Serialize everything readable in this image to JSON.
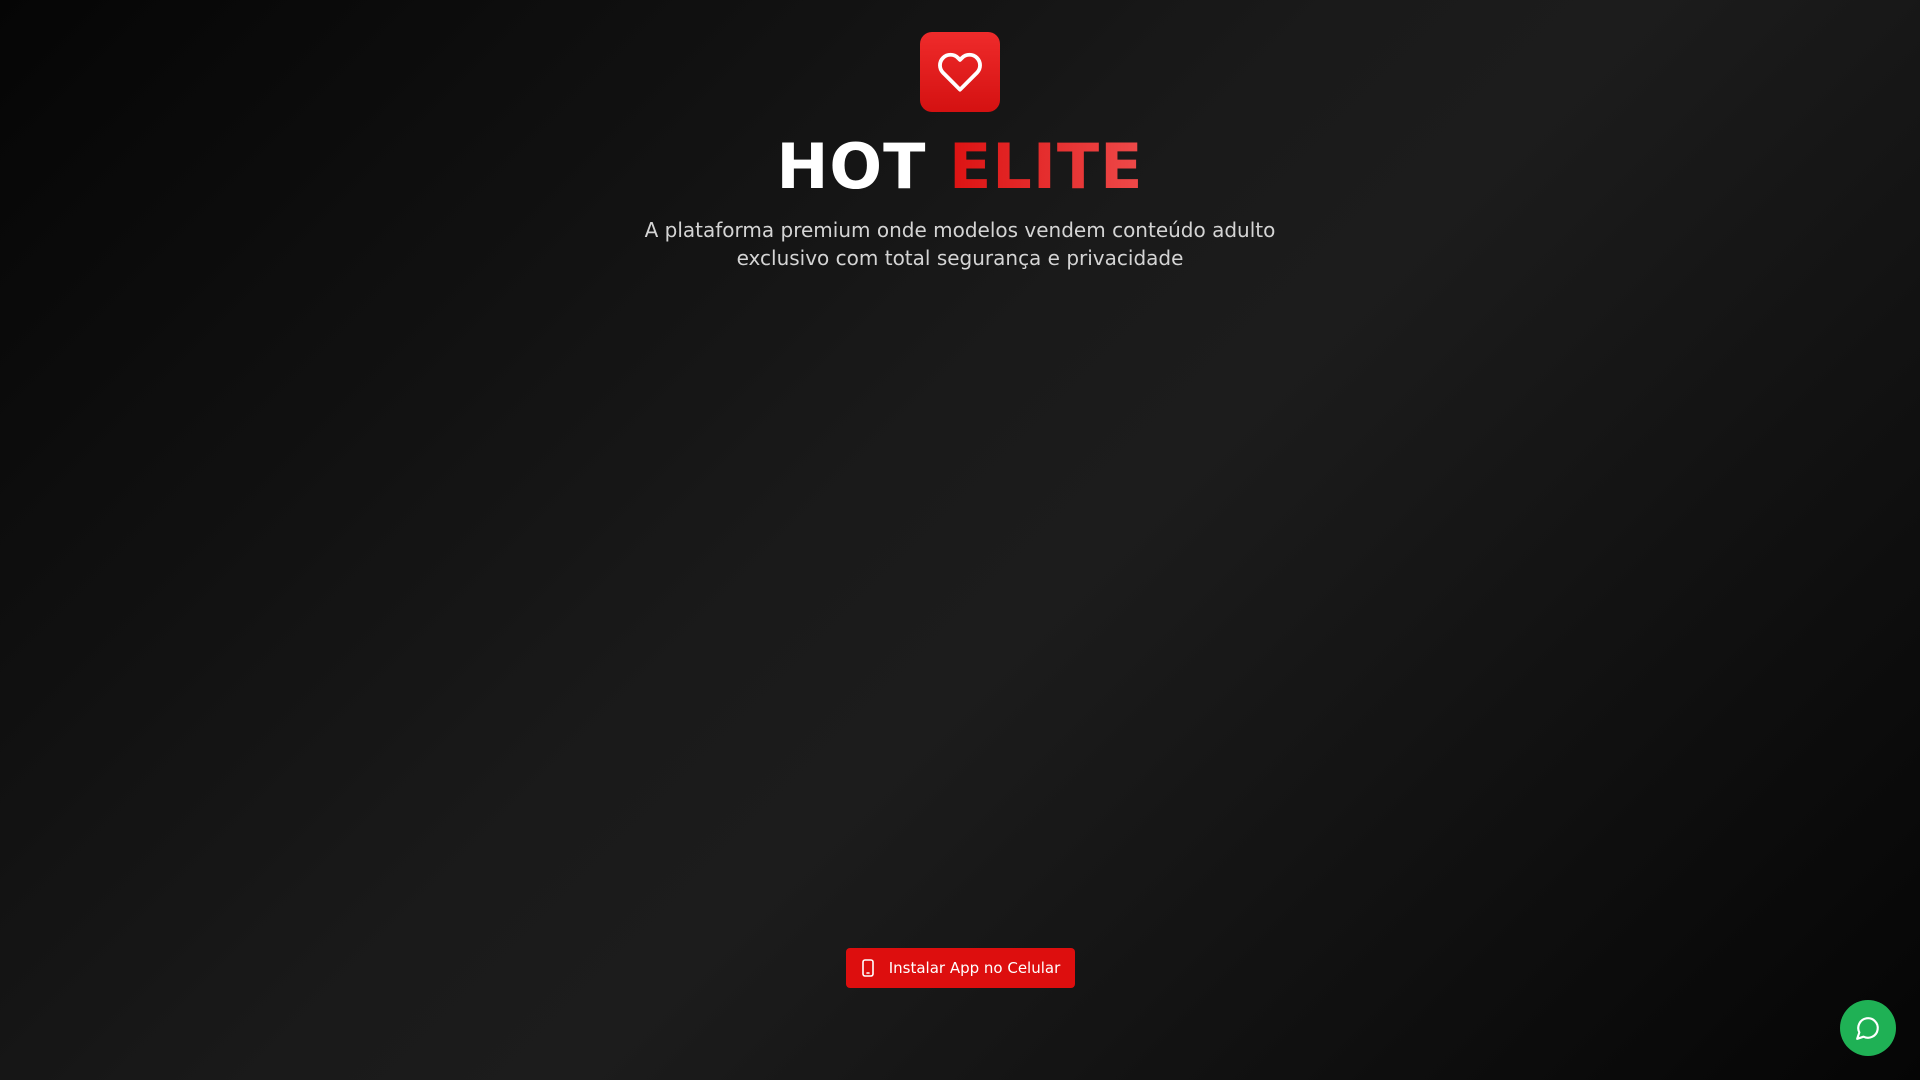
{
  "brand": {
    "word1": "HOT",
    "word2": "ELITE",
    "logo_icon": "heart-icon",
    "accent_color": "#dc1212"
  },
  "tagline": "A plataforma premium onde modelos vendem conteúdo adulto exclusivo com total segurança e privacidade",
  "install_button": {
    "label": "Instalar App no Celular",
    "icon": "smartphone-icon",
    "color": "#dd0e0e"
  },
  "chat_button": {
    "icon": "chat-bubble-icon",
    "color": "#1fb155"
  }
}
